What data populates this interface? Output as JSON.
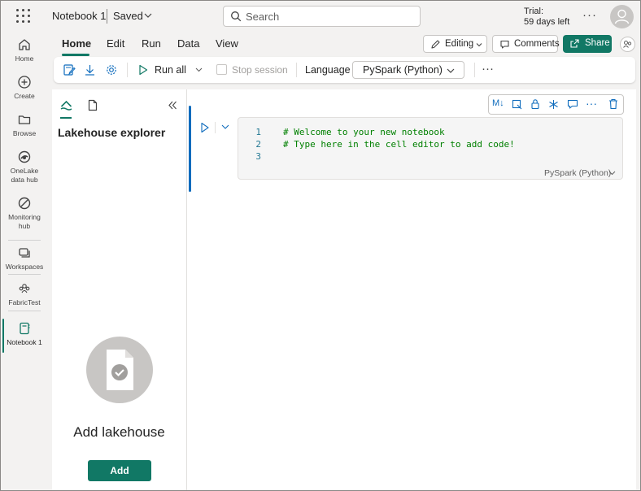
{
  "header": {
    "notebook_title": "Notebook 1",
    "save_status": "Saved",
    "search_placeholder": "Search",
    "trial_label": "Trial:",
    "trial_days": "59 days left"
  },
  "leftnav": {
    "items": [
      {
        "label": "Home",
        "icon": "home-icon"
      },
      {
        "label": "Create",
        "icon": "plus-circle-icon"
      },
      {
        "label": "Browse",
        "icon": "folder-icon"
      },
      {
        "label": "OneLake data hub",
        "line1": "OneLake",
        "line2": "data hub",
        "icon": "onelake-icon"
      },
      {
        "label": "Monitoring hub",
        "line1": "Monitoring",
        "line2": "hub",
        "icon": "monitoring-icon"
      },
      {
        "label": "Workspaces",
        "icon": "workspaces-icon"
      },
      {
        "label": "FabricTest",
        "icon": "workspace-people-icon"
      },
      {
        "label": "Notebook 1",
        "icon": "notebook-icon"
      }
    ]
  },
  "ribbon": {
    "tabs": [
      "Home",
      "Edit",
      "Run",
      "Data",
      "View"
    ],
    "active_tab": "Home",
    "editing_label": "Editing",
    "comments_label": "Comments",
    "share_label": "Share"
  },
  "toolbar": {
    "run_all_label": "Run all",
    "stop_session_label": "Stop session",
    "language_label": "Language",
    "language_value": "PySpark (Python)"
  },
  "explorer": {
    "title": "Lakehouse explorer",
    "empty_title": "Add lakehouse",
    "add_button": "Add"
  },
  "cell": {
    "lines": [
      {
        "num": "1",
        "code": "# Welcome to your new notebook"
      },
      {
        "num": "2",
        "code": "# Type here in the cell editor to add code!"
      },
      {
        "num": "3",
        "code": ""
      }
    ],
    "language": "PySpark (Python)",
    "toolbar_md_label": "M↓"
  },
  "colors": {
    "accent": "#117865",
    "cell_active_bar": "#0f6cbd",
    "code_comment": "#008000",
    "line_number": "#237893"
  }
}
